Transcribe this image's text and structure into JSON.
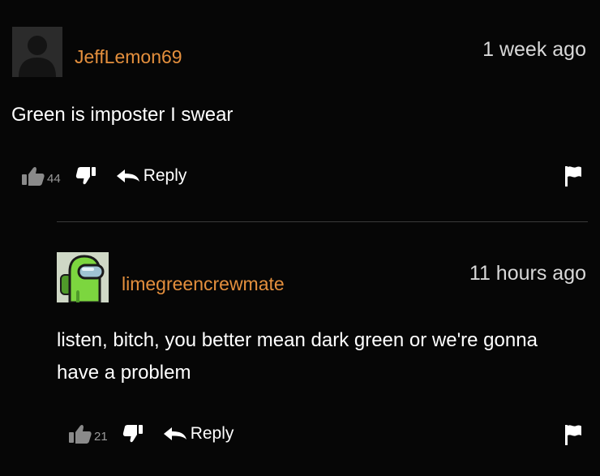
{
  "comments": [
    {
      "username": "JeffLemon69",
      "timestamp": "1 week ago",
      "text": "Green is imposter I swear",
      "likes": "44",
      "reply_label": "Reply",
      "avatar": "default-silhouette-avatar"
    },
    {
      "username": "limegreencrewmate",
      "timestamp": "11 hours ago",
      "text": "listen, bitch, you better mean dark green or we're gonna have a problem",
      "likes": "21",
      "reply_label": "Reply",
      "avatar": "lime-crewmate-avatar"
    }
  ],
  "colors": {
    "background": "#060606",
    "username": "#e48f3d",
    "text": "#ffffff",
    "timestamp": "#d8d8d8",
    "vote_count": "#9a9a9a",
    "crewmate_lime": "#7cd63f"
  },
  "icons": [
    "thumbs-up-icon",
    "thumbs-down-icon",
    "reply-arrow-icon",
    "flag-icon"
  ]
}
